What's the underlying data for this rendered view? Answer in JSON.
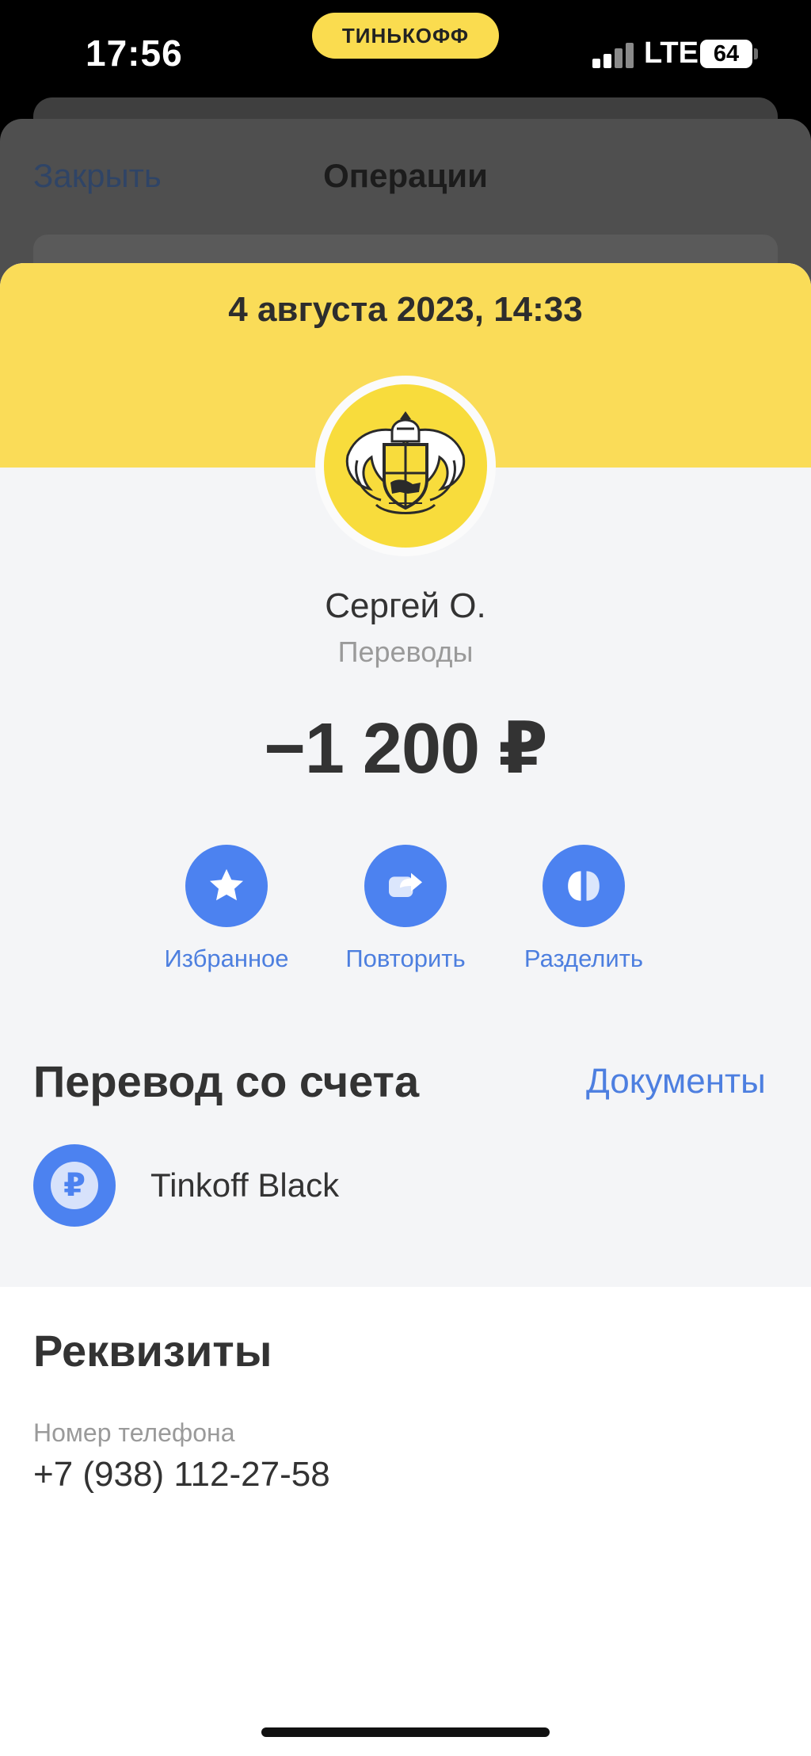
{
  "status_bar": {
    "time": "17:56",
    "brand": "ТИНЬКОФФ",
    "network": "LTE",
    "battery": "64",
    "icons": [
      "signal-icon",
      "battery-icon"
    ]
  },
  "background_sheet": {
    "close_label": "Закрыть",
    "title": "Операции"
  },
  "operation": {
    "date": "4 августа 2023, 14:33",
    "merchant_name": "Сергей О.",
    "category": "Переводы",
    "amount": "−1 200 ₽"
  },
  "actions": [
    {
      "label": "Избранное",
      "icon": "star-icon"
    },
    {
      "label": "Повторить",
      "icon": "repeat-icon"
    },
    {
      "label": "Разделить",
      "icon": "split-icon"
    }
  ],
  "source_section": {
    "title": "Перевод со счета",
    "documents_label": "Документы",
    "account_symbol": "₽",
    "account_name": "Tinkoff Black"
  },
  "details_section": {
    "title": "Реквизиты",
    "phone_label": "Номер телефона",
    "phone_value": "+7 (938) 112-27-58"
  },
  "colors": {
    "brand_yellow": "#fadc58",
    "accent_blue": "#4c82f0",
    "text_dark": "#333333",
    "text_muted": "#9a9a9a"
  }
}
